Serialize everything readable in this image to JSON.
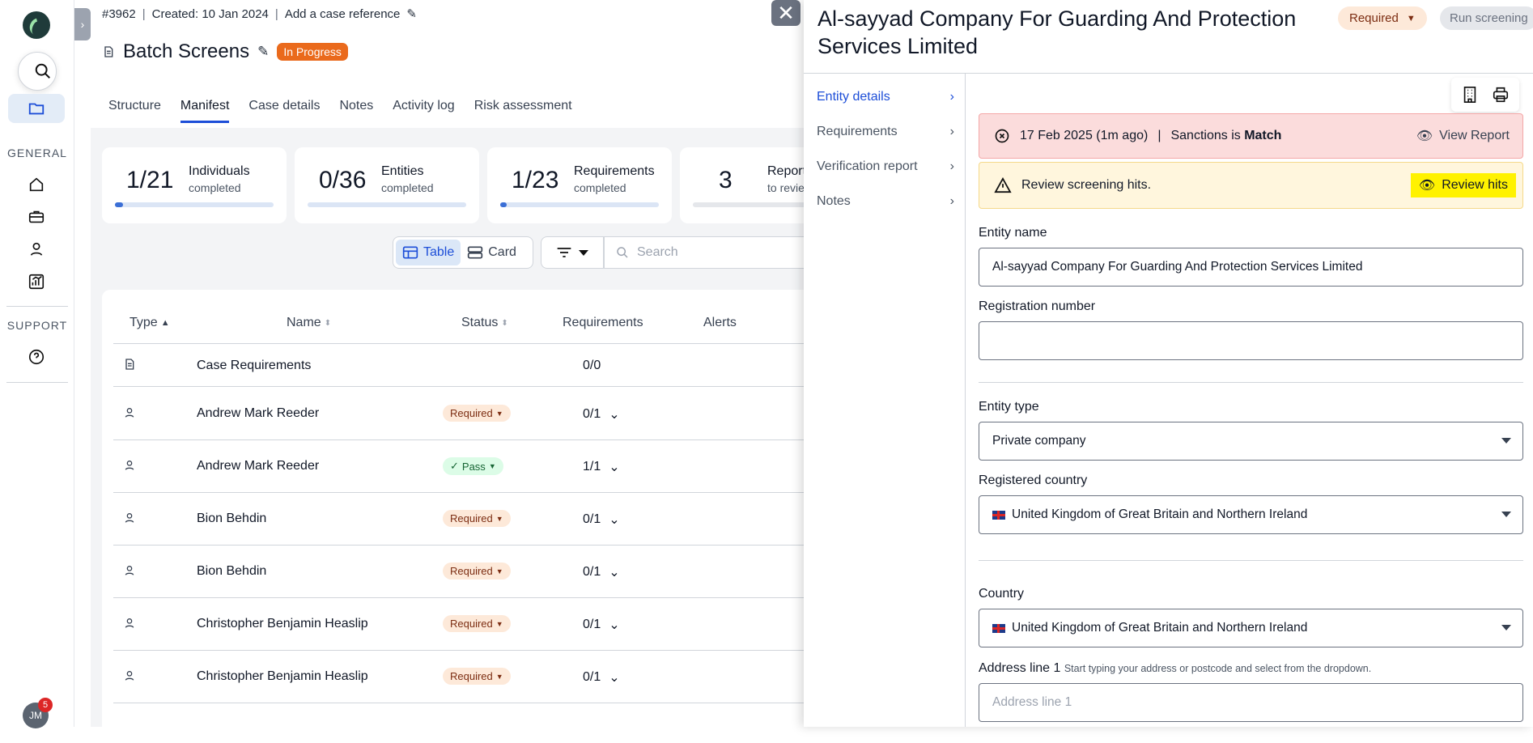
{
  "sidebar": {
    "general_label": "GENERAL",
    "support_label": "SUPPORT",
    "avatar_initials": "JM",
    "notification_count": "5"
  },
  "case": {
    "id": "#3962",
    "created": "Created: 10 Jan 2024",
    "reference_link": "Add a case reference",
    "title": "Batch Screens",
    "status": "In Progress"
  },
  "tabs": [
    "Structure",
    "Manifest",
    "Case details",
    "Notes",
    "Activity log",
    "Risk assessment"
  ],
  "stats": [
    {
      "num": "1/21",
      "label": "Individuals",
      "sub": "completed",
      "progress": 0.05
    },
    {
      "num": "0/36",
      "label": "Entities",
      "sub": "completed",
      "progress": 0
    },
    {
      "num": "1/23",
      "label": "Requirements",
      "sub": "completed",
      "progress": 0.04
    },
    {
      "num": "3",
      "label": "Report",
      "sub": "to revie",
      "progress": 0
    }
  ],
  "view_toggle": {
    "table": "Table",
    "card": "Card"
  },
  "search": {
    "placeholder": "Search"
  },
  "table": {
    "headers": {
      "type": "Type",
      "name": "Name",
      "status": "Status",
      "requirements": "Requirements",
      "alerts": "Alerts"
    },
    "rows": [
      {
        "name": "Case Requirements",
        "status": "",
        "req": "0/0"
      },
      {
        "name": "Andrew Mark Reeder",
        "status": "Required",
        "req": "0/1"
      },
      {
        "name": "Andrew Mark Reeder",
        "status": "Pass",
        "req": "1/1"
      },
      {
        "name": "Bion Behdin",
        "status": "Required",
        "req": "0/1"
      },
      {
        "name": "Bion Behdin",
        "status": "Required",
        "req": "0/1"
      },
      {
        "name": "Christopher Benjamin Heaslip",
        "status": "Required",
        "req": "0/1"
      },
      {
        "name": "Christopher Benjamin Heaslip",
        "status": "Required",
        "req": "0/1"
      }
    ]
  },
  "panel": {
    "title": "Al-sayyad Company For Guarding And Protection Services Limited",
    "required": "Required",
    "run": "Run screening",
    "nav": [
      "Entity details",
      "Requirements",
      "Verification report",
      "Notes"
    ],
    "alert_red": {
      "date": "17 Feb 2025 (1m ago)",
      "sep": "|",
      "text": "Sanctions is",
      "match": "Match",
      "action": "View Report"
    },
    "alert_yellow": {
      "text": "Review screening hits.",
      "action": "Review hits"
    },
    "fields": {
      "entity_name_label": "Entity name",
      "entity_name": "Al-sayyad Company For Guarding And Protection Services Limited",
      "reg_label": "Registration number",
      "reg_value": "",
      "type_label": "Entity type",
      "type_value": "Private company",
      "reg_country_label": "Registered country",
      "reg_country": "United Kingdom of Great Britain and Northern Ireland",
      "country_label": "Country",
      "country": "United Kingdom of Great Britain and Northern Ireland",
      "addr_label": "Address line 1",
      "addr_hint": "Start typing your address or postcode and select from the dropdown.",
      "addr_placeholder": "Address line 1"
    }
  }
}
